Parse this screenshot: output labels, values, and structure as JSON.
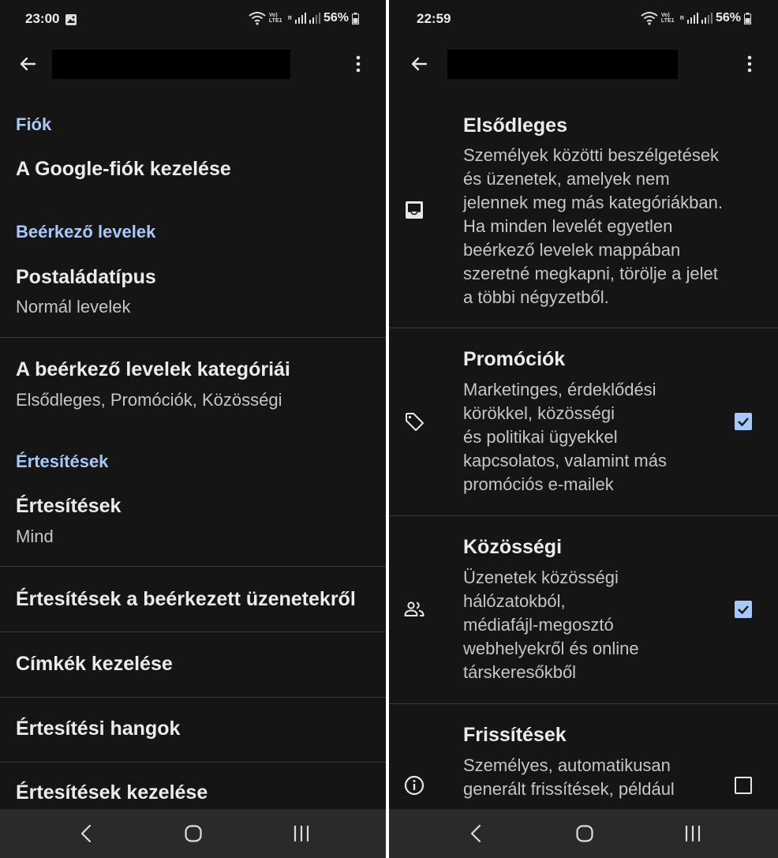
{
  "colors": {
    "background": "#151515",
    "accent": "#a8c7fa",
    "text_primary": "#ececec",
    "text_secondary": "#c6c6c6",
    "divider": "#3a3a3a",
    "navbar": "#2a2a2a"
  },
  "left": {
    "status": {
      "time": "23:00",
      "battery": "56%",
      "volte": "Vo) LTE1",
      "sim": "R"
    },
    "sections": {
      "account": {
        "header": "Fiók",
        "manage_account": "A Google-fiók kezelése"
      },
      "inbox": {
        "header": "Beérkező levelek",
        "inbox_type_title": "Postaládatípus",
        "inbox_type_value": "Normál levelek",
        "categories_title": "A beérkező levelek kategóriái",
        "categories_value": "Elsődleges, Promóciók, Közösségi"
      },
      "notifications": {
        "header": "Értesítések",
        "notifications_title": "Értesítések",
        "notifications_value": "Mind",
        "incoming_notifications": "Értesítések a beérkezett üzenetekről",
        "manage_labels": "Címkék kezelése",
        "notification_sounds": "Értesítési hangok",
        "manage_notifications": "Értesítések kezelése"
      }
    }
  },
  "right": {
    "status": {
      "time": "22:59",
      "battery": "56%",
      "volte": "Vo) LTE1",
      "sim": "R"
    },
    "categories": [
      {
        "title": "Elsődleges",
        "description": "Személyek közötti beszélgetések\nés üzenetek, amelyek nem\njelennek meg más kategóriákban.\nHa minden levelét egyetlen\nbeérkező levelek mappában\nszeretné megkapni, törölje a jelet\na többi négyzetből.",
        "icon": "inbox-icon"
      },
      {
        "title": "Promóciók",
        "description": "Marketinges, érdeklődési\nkörökkel, közösségi\nés politikai ügyekkel\nkapcsolatos, valamint más\npromóciós e-mailek",
        "icon": "tag-icon",
        "checked": true
      },
      {
        "title": "Közösségi",
        "description": "Üzenetek közösségi\nhálózatokból,\nmédiafájl-megosztó\nwebhelyekről és online\ntárskeresőkből",
        "icon": "people-icon",
        "checked": true
      },
      {
        "title": "Frissítések",
        "description": "Személyes, automatikusan\ngenerált frissítések, például",
        "icon": "info-icon",
        "checked": false
      }
    ]
  },
  "icons": {
    "back": "arrow-back-icon",
    "more": "more-vertical-icon",
    "nav_back": "nav-back-icon",
    "nav_home": "nav-home-icon",
    "nav_recents": "nav-recents-icon"
  }
}
